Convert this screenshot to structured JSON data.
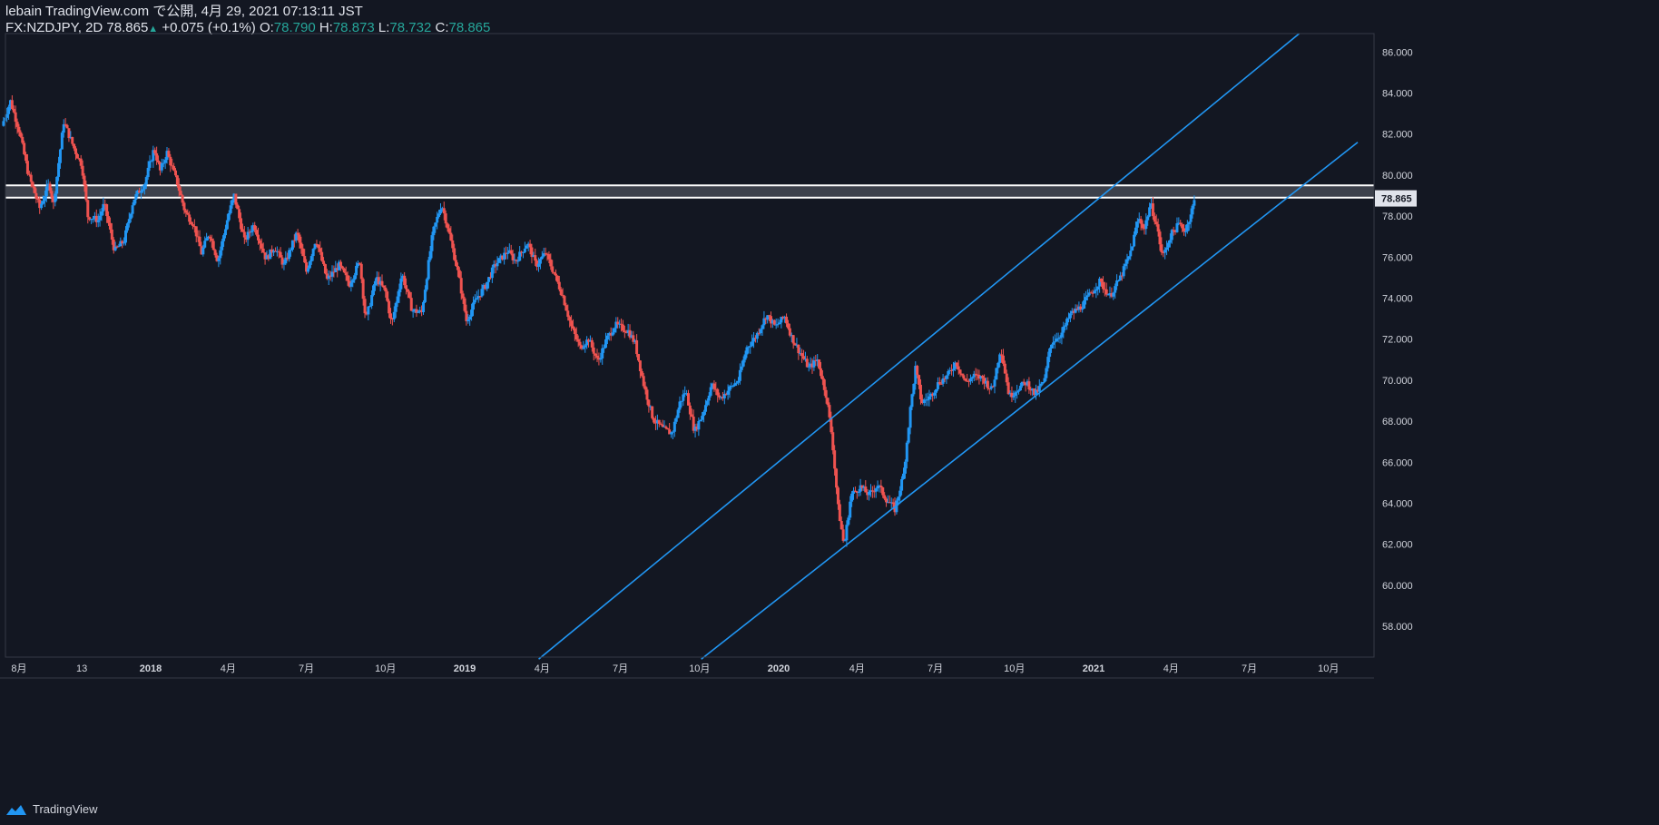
{
  "header": {
    "line1": "lebain TradingView.com で公開, 4月 29, 2021 07:13:11 JST",
    "symbol": "FX:NZDJPY, 2D 78.865",
    "arrow": "▲",
    "change": "+0.075 (+0.1%)",
    "o_label": "O:",
    "o_val": "78.790",
    "h_label": "H:",
    "h_val": "78.873",
    "l_label": "L:",
    "l_val": "78.732",
    "c_label": "C:",
    "c_val": "78.865"
  },
  "footer": {
    "brand": "TradingView"
  },
  "colors": {
    "background": "#131722",
    "up": "#2196f3",
    "down": "#ef5350",
    "trendline": "#2196f3",
    "zone_fill": "#434651",
    "zone_border": "#ffffff",
    "grid_axis_text": "#d1d4dc"
  },
  "chart_data": {
    "type": "candlestick",
    "symbol": "FX:NZDJPY",
    "timeframe": "2D",
    "last_price": 78.865,
    "ylim": [
      56.5,
      86.9
    ],
    "y_ticks": [
      58,
      60,
      62,
      64,
      66,
      68,
      70,
      72,
      74,
      76,
      78,
      80,
      82,
      84,
      86
    ],
    "y_tick_labels": [
      "58.000",
      "60.000",
      "62.000",
      "64.000",
      "66.000",
      "68.000",
      "70.000",
      "72.000",
      "74.000",
      "76.000",
      "78.000",
      "80.000",
      "82.000",
      "84.000",
      "86.000"
    ],
    "last_price_label": "78.865",
    "x_ticks": [
      {
        "date": "2017-08-01",
        "label": "8月"
      },
      {
        "date": "2017-10-13",
        "label": "13"
      },
      {
        "date": "2018-01-01",
        "label": "2018"
      },
      {
        "date": "2018-04-01",
        "label": "4月"
      },
      {
        "date": "2018-07-01",
        "label": "7月"
      },
      {
        "date": "2018-10-01",
        "label": "10月"
      },
      {
        "date": "2019-01-01",
        "label": "2019"
      },
      {
        "date": "2019-04-01",
        "label": "4月"
      },
      {
        "date": "2019-07-01",
        "label": "7月"
      },
      {
        "date": "2019-10-01",
        "label": "10月"
      },
      {
        "date": "2020-01-01",
        "label": "2020"
      },
      {
        "date": "2020-04-01",
        "label": "4月"
      },
      {
        "date": "2020-07-01",
        "label": "7月"
      },
      {
        "date": "2020-10-01",
        "label": "10月"
      },
      {
        "date": "2021-01-01",
        "label": "2021"
      },
      {
        "date": "2021-04-01",
        "label": "4月"
      },
      {
        "date": "2021-07-01",
        "label": "7月"
      },
      {
        "date": "2021-10-01",
        "label": "10月"
      }
    ],
    "price_path": [
      [
        "2017-07-12",
        82.4
      ],
      [
        "2017-07-22",
        83.6
      ],
      [
        "2017-08-01",
        82.2
      ],
      [
        "2017-08-12",
        80.0
      ],
      [
        "2017-08-25",
        78.4
      ],
      [
        "2017-09-05",
        79.6
      ],
      [
        "2017-09-10",
        78.6
      ],
      [
        "2017-09-22",
        82.6
      ],
      [
        "2017-10-05",
        81.2
      ],
      [
        "2017-10-13",
        80.5
      ],
      [
        "2017-10-20",
        78.0
      ],
      [
        "2017-11-01",
        77.8
      ],
      [
        "2017-11-08",
        78.6
      ],
      [
        "2017-11-20",
        76.3
      ],
      [
        "2017-12-01",
        76.8
      ],
      [
        "2017-12-12",
        78.8
      ],
      [
        "2017-12-25",
        79.6
      ],
      [
        "2018-01-05",
        81.3
      ],
      [
        "2018-01-12",
        80.2
      ],
      [
        "2018-01-20",
        81.1
      ],
      [
        "2018-02-01",
        79.6
      ],
      [
        "2018-02-10",
        78.2
      ],
      [
        "2018-02-20",
        77.6
      ],
      [
        "2018-03-01",
        76.2
      ],
      [
        "2018-03-10",
        77.2
      ],
      [
        "2018-03-20",
        75.8
      ],
      [
        "2018-04-01",
        78.0
      ],
      [
        "2018-04-08",
        79.0
      ],
      [
        "2018-04-20",
        76.8
      ],
      [
        "2018-05-01",
        77.6
      ],
      [
        "2018-05-15",
        75.9
      ],
      [
        "2018-05-25",
        76.5
      ],
      [
        "2018-06-05",
        75.6
      ],
      [
        "2018-06-20",
        77.2
      ],
      [
        "2018-07-01",
        75.3
      ],
      [
        "2018-07-12",
        76.9
      ],
      [
        "2018-07-25",
        74.9
      ],
      [
        "2018-08-08",
        75.6
      ],
      [
        "2018-08-20",
        74.7
      ],
      [
        "2018-09-01",
        75.8
      ],
      [
        "2018-09-08",
        72.9
      ],
      [
        "2018-09-20",
        75.0
      ],
      [
        "2018-10-01",
        74.3
      ],
      [
        "2018-10-08",
        72.7
      ],
      [
        "2018-10-20",
        75.2
      ],
      [
        "2018-11-01",
        73.4
      ],
      [
        "2018-11-12",
        73.3
      ],
      [
        "2018-11-25",
        77.2
      ],
      [
        "2018-12-05",
        78.6
      ],
      [
        "2018-12-12",
        77.5
      ],
      [
        "2018-12-25",
        75.1
      ],
      [
        "2019-01-03",
        72.9
      ],
      [
        "2019-01-15",
        74.0
      ],
      [
        "2019-01-25",
        74.6
      ],
      [
        "2019-02-05",
        75.6
      ],
      [
        "2019-02-20",
        76.3
      ],
      [
        "2019-03-01",
        75.8
      ],
      [
        "2019-03-15",
        76.7
      ],
      [
        "2019-03-25",
        75.6
      ],
      [
        "2019-04-05",
        76.2
      ],
      [
        "2019-04-15",
        75.2
      ],
      [
        "2019-04-25",
        74.1
      ],
      [
        "2019-05-05",
        72.6
      ],
      [
        "2019-05-15",
        71.6
      ],
      [
        "2019-05-25",
        72.0
      ],
      [
        "2019-06-05",
        70.9
      ],
      [
        "2019-06-15",
        72.0
      ],
      [
        "2019-06-25",
        72.7
      ],
      [
        "2019-07-10",
        72.4
      ],
      [
        "2019-07-18",
        71.8
      ],
      [
        "2019-07-28",
        69.8
      ],
      [
        "2019-08-08",
        68.1
      ],
      [
        "2019-08-20",
        67.6
      ],
      [
        "2019-08-30",
        67.4
      ],
      [
        "2019-09-08",
        68.9
      ],
      [
        "2019-09-15",
        69.5
      ],
      [
        "2019-09-25",
        67.5
      ],
      [
        "2019-10-05",
        68.4
      ],
      [
        "2019-10-15",
        69.8
      ],
      [
        "2019-10-25",
        69.1
      ],
      [
        "2019-11-05",
        69.6
      ],
      [
        "2019-11-15",
        70.0
      ],
      [
        "2019-11-25",
        71.6
      ],
      [
        "2019-12-05",
        72.1
      ],
      [
        "2019-12-18",
        73.2
      ],
      [
        "2019-12-28",
        72.6
      ],
      [
        "2020-01-08",
        73.1
      ],
      [
        "2020-01-16",
        72.1
      ],
      [
        "2020-01-25",
        71.4
      ],
      [
        "2020-02-05",
        70.6
      ],
      [
        "2020-02-15",
        71.0
      ],
      [
        "2020-02-25",
        69.3
      ],
      [
        "2020-03-03",
        67.2
      ],
      [
        "2020-03-10",
        63.8
      ],
      [
        "2020-03-17",
        61.9
      ],
      [
        "2020-03-25",
        64.4
      ],
      [
        "2020-04-05",
        64.8
      ],
      [
        "2020-04-15",
        64.4
      ],
      [
        "2020-04-25",
        64.9
      ],
      [
        "2020-05-05",
        64.2
      ],
      [
        "2020-05-15",
        63.7
      ],
      [
        "2020-05-25",
        65.4
      ],
      [
        "2020-06-02",
        68.6
      ],
      [
        "2020-06-08",
        70.6
      ],
      [
        "2020-06-15",
        68.9
      ],
      [
        "2020-06-25",
        69.2
      ],
      [
        "2020-07-05",
        69.9
      ],
      [
        "2020-07-15",
        70.2
      ],
      [
        "2020-07-25",
        70.9
      ],
      [
        "2020-08-05",
        69.9
      ],
      [
        "2020-08-15",
        70.2
      ],
      [
        "2020-08-25",
        70.1
      ],
      [
        "2020-09-05",
        69.5
      ],
      [
        "2020-09-15",
        71.6
      ],
      [
        "2020-09-25",
        69.2
      ],
      [
        "2020-10-05",
        69.6
      ],
      [
        "2020-10-15",
        69.9
      ],
      [
        "2020-10-25",
        69.3
      ],
      [
        "2020-11-05",
        70.0
      ],
      [
        "2020-11-12",
        71.8
      ],
      [
        "2020-11-25",
        72.3
      ],
      [
        "2020-12-05",
        73.2
      ],
      [
        "2020-12-18",
        73.6
      ],
      [
        "2020-12-28",
        74.2
      ],
      [
        "2021-01-08",
        74.8
      ],
      [
        "2021-01-20",
        74.1
      ],
      [
        "2021-02-01",
        75.0
      ],
      [
        "2021-02-12",
        76.1
      ],
      [
        "2021-02-22",
        77.9
      ],
      [
        "2021-03-01",
        77.4
      ],
      [
        "2021-03-08",
        78.6
      ],
      [
        "2021-03-15",
        77.6
      ],
      [
        "2021-03-22",
        76.0
      ],
      [
        "2021-04-01",
        77.1
      ],
      [
        "2021-04-10",
        77.6
      ],
      [
        "2021-04-18",
        77.3
      ],
      [
        "2021-04-29",
        78.865
      ]
    ],
    "annotations": {
      "resistance_zone": {
        "top": 79.5,
        "bottom": 78.9
      },
      "channel_upper": {
        "from": [
          "2019-03-28",
          56.4
        ],
        "to": [
          "2021-08-28",
          86.9
        ]
      },
      "channel_lower": {
        "from": [
          "2019-10-03",
          56.4
        ],
        "to": [
          "2021-11-04",
          81.6
        ]
      }
    },
    "title": "",
    "xlabel": "",
    "ylabel": ""
  }
}
